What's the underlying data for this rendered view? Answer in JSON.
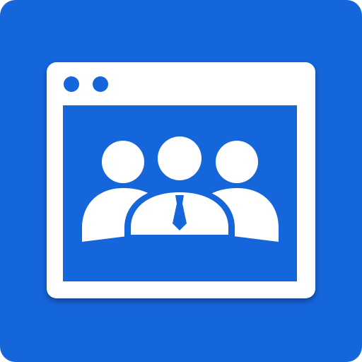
{
  "icon": {
    "name": "team-browser-window-icon",
    "tile_color": "#1565DB",
    "window_color": "#FFFFFF",
    "screen_color": "#1565DB",
    "people_color": "#FFFFFF",
    "tie_color": "#1565DB"
  }
}
